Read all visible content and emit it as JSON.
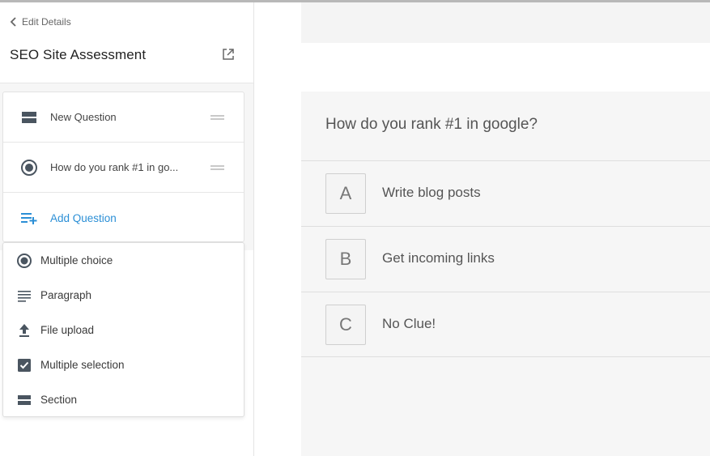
{
  "sidebar": {
    "back_label": "Edit Details",
    "title": "SEO Site Assessment",
    "questions": [
      {
        "label": "New Question",
        "icon": "section-icon"
      },
      {
        "label": "How do you rank #1 in go...",
        "icon": "radio-icon"
      }
    ],
    "add_question_label": "Add Question",
    "add_menu": [
      {
        "label": "Multiple choice",
        "icon": "radio-icon"
      },
      {
        "label": "Paragraph",
        "icon": "paragraph-icon"
      },
      {
        "label": "File upload",
        "icon": "upload-icon"
      },
      {
        "label": "Multiple selection",
        "icon": "checkbox-icon"
      },
      {
        "label": "Section",
        "icon": "section-icon"
      }
    ]
  },
  "preview": {
    "question": "How do you rank #1 in google?",
    "options": [
      {
        "letter": "A",
        "text": "Write blog posts"
      },
      {
        "letter": "B",
        "text": "Get incoming links"
      },
      {
        "letter": "C",
        "text": "No Clue!"
      }
    ]
  },
  "colors": {
    "accent": "#2b8fd6",
    "icon": "#4a5560",
    "panel_bg": "#f6f6f6"
  }
}
